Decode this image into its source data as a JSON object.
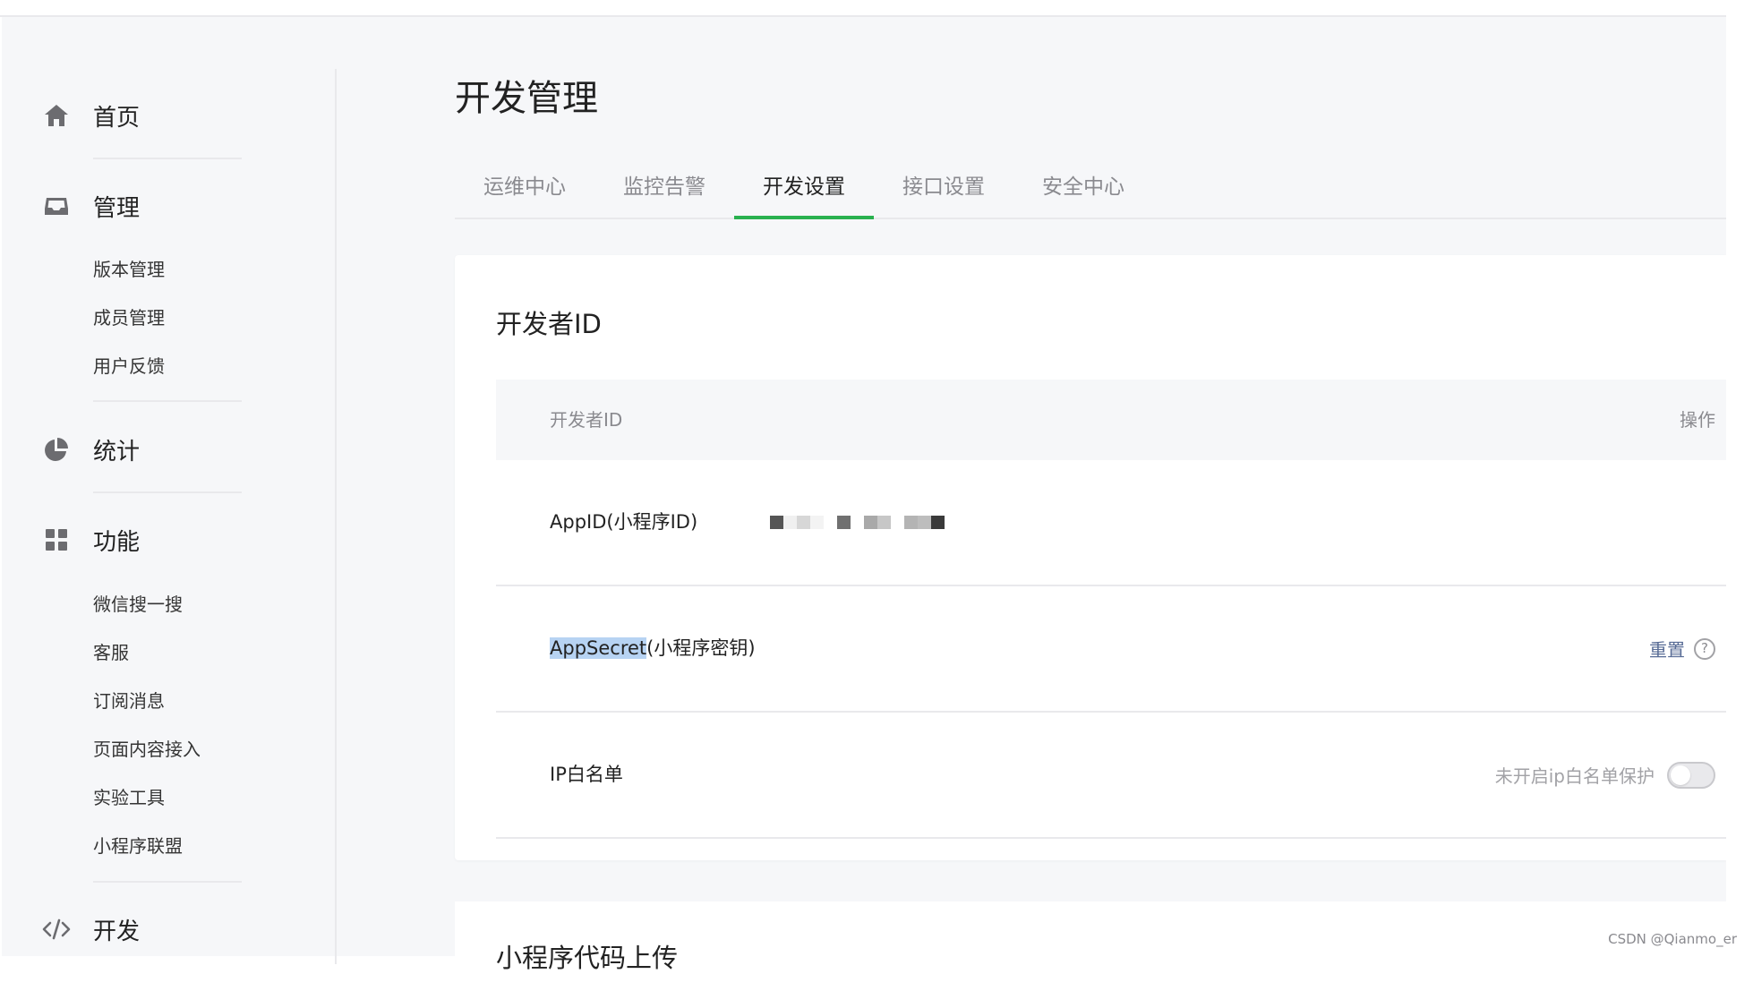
{
  "sidebar": {
    "groups": [
      {
        "label": "首页",
        "icon": "home-icon",
        "items": []
      },
      {
        "label": "管理",
        "icon": "inbox-icon",
        "items": [
          "版本管理",
          "成员管理",
          "用户反馈"
        ]
      },
      {
        "label": "统计",
        "icon": "pie-chart-icon",
        "items": []
      },
      {
        "label": "功能",
        "icon": "grid-icon",
        "items": [
          "微信搜一搜",
          "客服",
          "订阅消息",
          "页面内容接入",
          "实验工具",
          "小程序联盟"
        ]
      },
      {
        "label": "开发",
        "icon": "code-icon",
        "items": []
      }
    ]
  },
  "main": {
    "title": "开发管理",
    "tabs": [
      {
        "label": "运维中心",
        "active": false
      },
      {
        "label": "监控告警",
        "active": false
      },
      {
        "label": "开发设置",
        "active": true
      },
      {
        "label": "接口设置",
        "active": false
      },
      {
        "label": "安全中心",
        "active": false
      }
    ],
    "dev_id_card": {
      "title": "开发者ID",
      "table": {
        "col_name": "开发者ID",
        "col_action": "操作",
        "rows": [
          {
            "label": "AppID(小程序ID)",
            "value_masked": true
          },
          {
            "label_highlight": "AppSecret",
            "label_rest": "(小程序密钥)",
            "action": "重置",
            "help": "?"
          },
          {
            "label": "IP白名单",
            "status": "未开启ip白名单保护",
            "toggle_on": false
          }
        ]
      }
    },
    "next_card_title": "小程序代码上传"
  },
  "colors": {
    "accent": "#29b14f",
    "link": "#576b95",
    "highlight": "#b7d3f3"
  },
  "watermark": "CSDN @Qianmo_er"
}
